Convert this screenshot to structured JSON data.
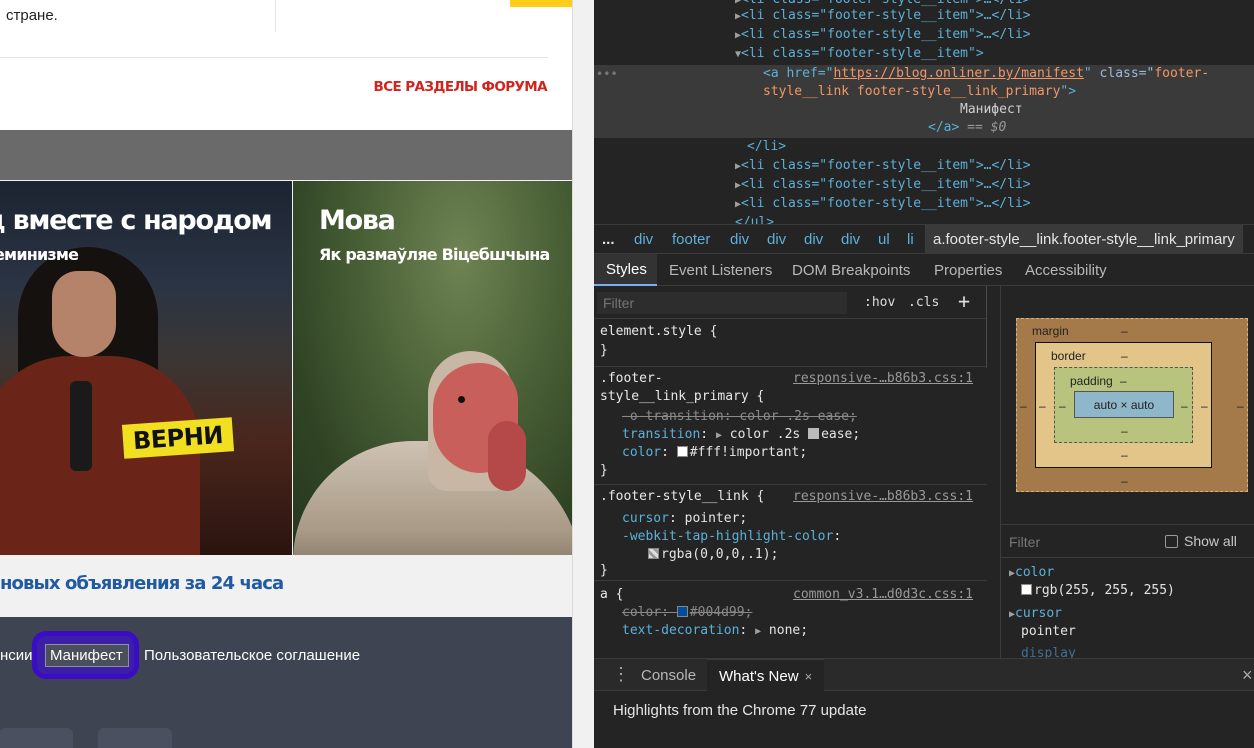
{
  "webpage": {
    "forum_snippet": "стране.",
    "all_forum_link": "ВСЕ РАЗДЕЛЫ ФОРУМА",
    "tile1": {
      "title": "д вместе с народом",
      "subtitle": "еминизме",
      "badge": "ВЕРНИ"
    },
    "tile2": {
      "title": "Мова",
      "subtitle": "Як размаўляе Віцебшчына"
    },
    "new_ads": "новых объявления за 24 часа",
    "footer_links": [
      "нсии",
      "Манифест",
      "Пользовательское соглашение"
    ]
  },
  "devtools": {
    "elements": {
      "lines": [
        {
          "open": "<li class=\"footer-style__item\">",
          "tail": "…</li>"
        },
        {
          "open": "<li class=\"footer-style__item\">",
          "tail": "…</li>"
        },
        {
          "open": "<li class=\"footer-style__item\">",
          "tail": ""
        }
      ],
      "selected": {
        "tag_open": "<a href=\"",
        "href": "https://blog.onliner.by/manifest",
        "class_attr": " class=\"",
        "class_val1": "footer-",
        "class_val2": "style__link footer-style__link_primary",
        "close1": "\">",
        "text": "Манифест",
        "close_tag": "</a>",
        "eq": " == $0"
      },
      "li_close": "</li>",
      "after_lines": [
        "<li class=\"footer-style__item\">…</li>",
        "<li class=\"footer-style__item\">…</li>",
        "<li class=\"footer-style__item\">…</li>"
      ],
      "ul_close": "</ul>"
    },
    "breadcrumbs": [
      "...",
      "div",
      "footer",
      "div",
      "div",
      "div",
      "div",
      "ul",
      "li"
    ],
    "breadcrumb_last": "a.footer-style__link.footer-style__link_primary",
    "panel_tabs": [
      "Styles",
      "Event Listeners",
      "DOM Breakpoints",
      "Properties",
      "Accessibility"
    ],
    "styles": {
      "filter_placeholder": "Filter",
      "hov": ":hov",
      "cls": ".cls",
      "plus": "+",
      "element_style": "element.style {",
      "close_brace": "}",
      "rule1": {
        "sel1": ".footer-",
        "sel2": "style__link_primary {",
        "src": "responsive-…b86b3.css:1",
        "p1": "-o-transition: color .2s ease;",
        "p2_name": "transition",
        "p2_val": "color .2s",
        "p2_val2": "ease;",
        "p3_name": "color",
        "p3_val": "#fff!important;"
      },
      "rule2": {
        "sel": ".footer-style__link {",
        "src": "responsive-…b86b3.css:1",
        "p1_name": "cursor",
        "p1_val": "pointer;",
        "p2_name": "-webkit-tap-highlight-color",
        "p2_val": "rgba(0,0,0,.1);"
      },
      "rule3": {
        "sel": "a {",
        "src": "common_v3.1…d0d3c.css:1",
        "p1_name": "color",
        "p1_val": "#004d99;",
        "p2_name": "text-decoration",
        "p2_val": "none;"
      }
    },
    "box_model": {
      "margin_label": "margin",
      "border_label": "border",
      "padding_label": "padding",
      "content": "auto × auto",
      "dash": "–"
    },
    "computed": {
      "filter_placeholder": "Filter",
      "show_all": "Show all",
      "props": [
        {
          "name": "color",
          "value": "rgb(255, 255, 255)"
        },
        {
          "name": "cursor",
          "value": "pointer"
        }
      ],
      "partial": "display"
    },
    "drawer": {
      "tabs": [
        "Console",
        "What's New"
      ],
      "close_x": "×",
      "whatsnew_text": "Highlights from the Chrome 77 update"
    },
    "colors": {
      "link_red": "#d4231d",
      "link_blue": "#1f5aa3",
      "footer_bg": "#3e4451",
      "annotation": "#3a0cc5",
      "tag": "#5db0d7",
      "attr_value": "#f29766"
    }
  }
}
